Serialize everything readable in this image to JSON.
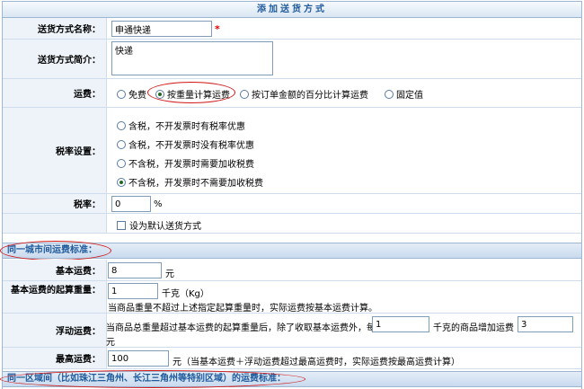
{
  "title": "添加送货方式",
  "form": {
    "name_label": "送货方式名称：",
    "name_value": "申通快递",
    "required_mark": "*",
    "desc_label": "送货方式简介：",
    "desc_value": "快递",
    "fee_label": "运费：",
    "fee_options": [
      "免费",
      "按重量计算运费",
      "按订单金额的百分比计算运费",
      "固定值"
    ],
    "fee_selected": "按重量计算运费",
    "tax_label": "税率设置：",
    "tax_options": [
      "含税，不开发票时有税率优惠",
      "含税，不开发票时没有税率优惠",
      "不含税，开发票时需要加收税费",
      "不含税，开发票时不需要加收税费"
    ],
    "tax_selected": "不含税，开发票时不需要加收税费",
    "rate_label": "税率：",
    "rate_value": "0",
    "rate_unit": "%",
    "default_label": "设为默认送货方式"
  },
  "section1": {
    "title": "同一城市间运费标准：",
    "base_fee_label": "基本运费：",
    "base_fee_value": "8",
    "base_fee_unit": "元",
    "start_weight_label": "基本运费的起算重量：",
    "start_weight_value": "1",
    "start_weight_unit": "千克（Kg）",
    "start_weight_note": "当商品重量不超过上述指定起算重量时，实际运费按基本运费计算。",
    "float_label": "浮动运费：",
    "float_text_a": "当商品总重量超过基本运费的起算重量后，除了收取基本运费外，每",
    "float_weight_value": "1",
    "float_text_b": "千克的商品增加运费",
    "float_fee_value": "3",
    "float_unit": "元",
    "max_label": "最高运费：",
    "max_value": "100",
    "max_note": "元（当基本运费＋浮动运费超过最高运费时，实际运费按最高运费计算）"
  },
  "section2": {
    "title": "同一区域间（比如珠江三角州、长江三角州等特别区域）的运费标准："
  }
}
